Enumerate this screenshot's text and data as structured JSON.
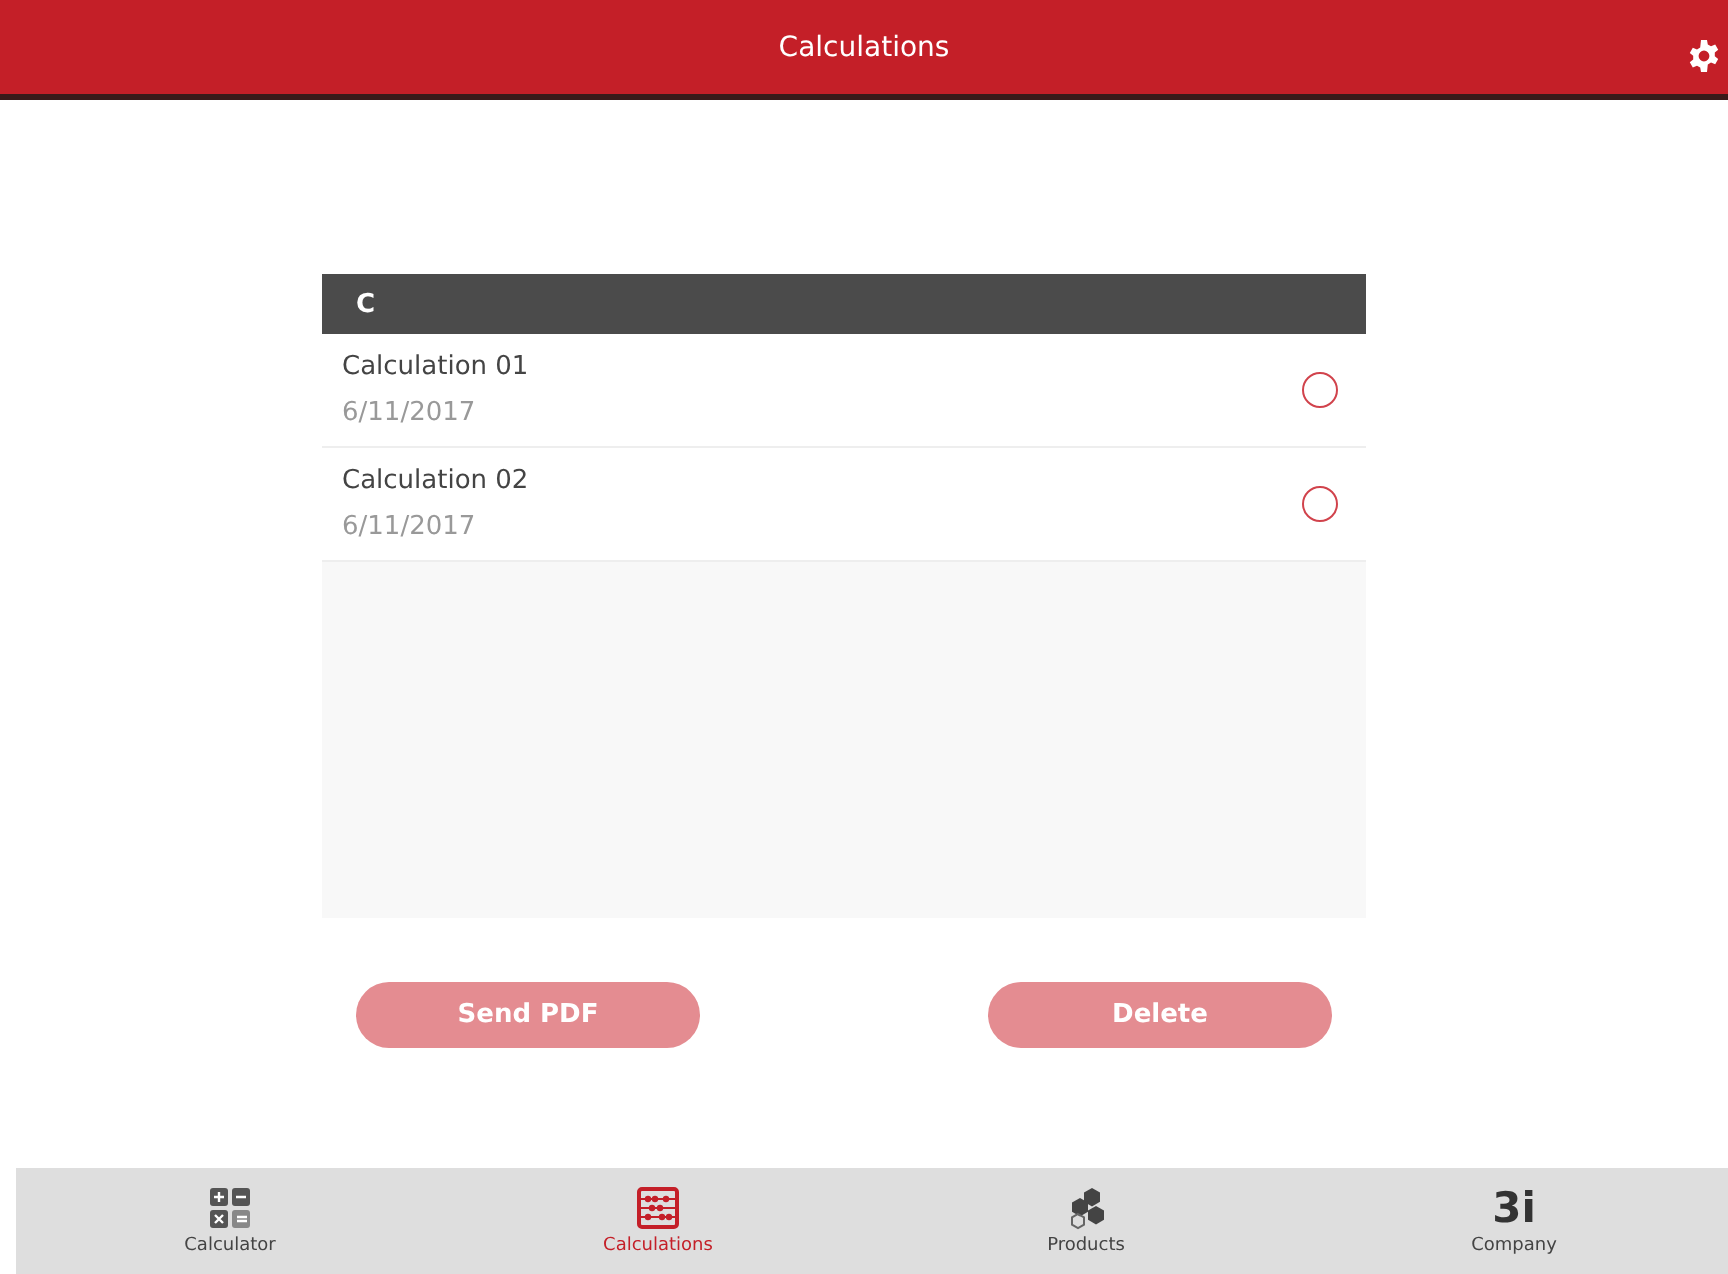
{
  "header": {
    "title": "Calculations"
  },
  "list": {
    "section": "C",
    "items": [
      {
        "name": "Calculation 01",
        "date": "6/11/2017",
        "selected": false
      },
      {
        "name": "Calculation 02",
        "date": "6/11/2017",
        "selected": false
      }
    ]
  },
  "buttons": [
    {
      "label": "Send PDF",
      "disabled": true
    },
    {
      "label": "Delete",
      "disabled": true
    }
  ],
  "tabs": [
    {
      "kind": "calculator",
      "label": "Calculator",
      "selected": false
    },
    {
      "kind": "abacus",
      "label": "Calculations",
      "selected": true
    },
    {
      "kind": "hexagons",
      "label": "Products",
      "selected": false
    },
    {
      "kind": "logo",
      "logo_text": "3i",
      "label": "Company",
      "selected": false
    }
  ]
}
